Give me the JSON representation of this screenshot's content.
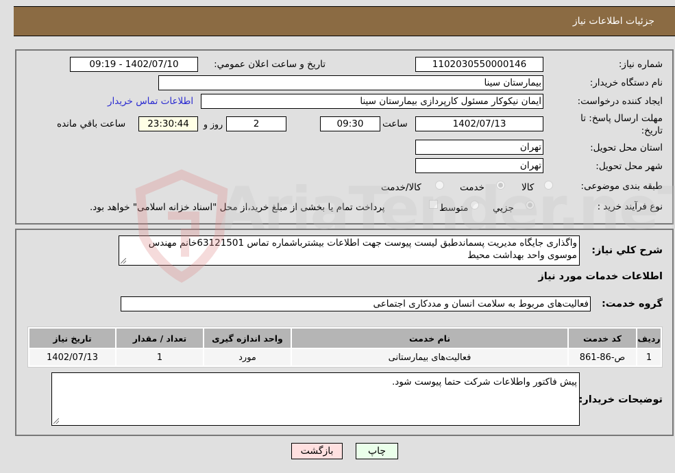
{
  "header": {
    "title": "جزئیات اطلاعات نیاز"
  },
  "form": {
    "need_number": {
      "label": "شماره نیاز:",
      "value": "1102030550000146"
    },
    "announce_datetime": {
      "label": "تاریخ و ساعت اعلان عمومي:",
      "value": "1402/07/10 - 09:19"
    },
    "buyer_org": {
      "label": "نام دستگاه خریدار:",
      "value": "بیمارستان سینا"
    },
    "requester": {
      "label": "ایجاد کننده درخواست:",
      "value": "ایمان نیکوکار مسئول کارپردازی  بیمارستان سینا",
      "contact_link": "اطلاعات تماس خریدار"
    },
    "deadline": {
      "label_line1": "مهلت ارسال پاسخ: تا",
      "label_line2": "تاریخ:",
      "date": "1402/07/13",
      "time_label": "ساعت",
      "time": "09:30",
      "days": "2",
      "days_label": "روز و",
      "remaining": "23:30:44",
      "remaining_label": "ساعت باقي مانده"
    },
    "province": {
      "label": "استان محل تحویل:",
      "value": "تهران"
    },
    "city": {
      "label": "شهر محل تحویل:",
      "value": "تهران"
    },
    "category": {
      "label": "طبقه بندی موضوعی:",
      "options": [
        {
          "label": "کالا",
          "selected": false
        },
        {
          "label": "خدمت",
          "selected": true
        },
        {
          "label": "کالا/خدمت",
          "selected": false
        }
      ]
    },
    "process_type": {
      "label": "نوع فرآیند خرید :",
      "options": [
        {
          "label": "جزيي",
          "selected": true
        },
        {
          "label": "متوسط",
          "selected": false
        }
      ],
      "payment_note": "پرداخت تمام یا بخشی از مبلغ خرید،از محل \"اسناد خزانه اسلامی\" خواهد بود.",
      "payment_checked": false
    }
  },
  "description": {
    "label": "شرح کلي نیاز:",
    "value": "واگذاری جایگاه مدیریت پسماندطبق لیست پیوست جهت اطلاعات بیشترباشماره تماس 63121501خانم مهندس موسوی واحد بهداشت محیط"
  },
  "services": {
    "section_title": "اطلاعات خدمات مورد نیاز",
    "group_label": "گروه خدمت:",
    "group_value": "فعالیت‌های مربوط به سلامت انسان و مددکاری اجتماعی",
    "columns": [
      "ردیف",
      "کد خدمت",
      "نام خدمت",
      "واحد اندازه گیری",
      "تعداد / مقدار",
      "تاریخ نیاز"
    ],
    "rows": [
      [
        "1",
        "ص-86-861",
        "فعالیت‌های بیمارستانی",
        "مورد",
        "1",
        "1402/07/13"
      ]
    ]
  },
  "buyer_notes": {
    "label": "توضیحات خریدار:",
    "value": "پیش فاکتور واطلاعات شرکت حتما پیوست شود."
  },
  "buttons": {
    "print": "چاپ",
    "back": "بازگشت"
  },
  "watermark": {
    "text": "AriaTender.neT"
  },
  "colors": {
    "header_bg": "#8b6b43",
    "print_bg": "#eaffea",
    "back_bg": "#ffe0e0",
    "link": "#2a2ad0"
  }
}
